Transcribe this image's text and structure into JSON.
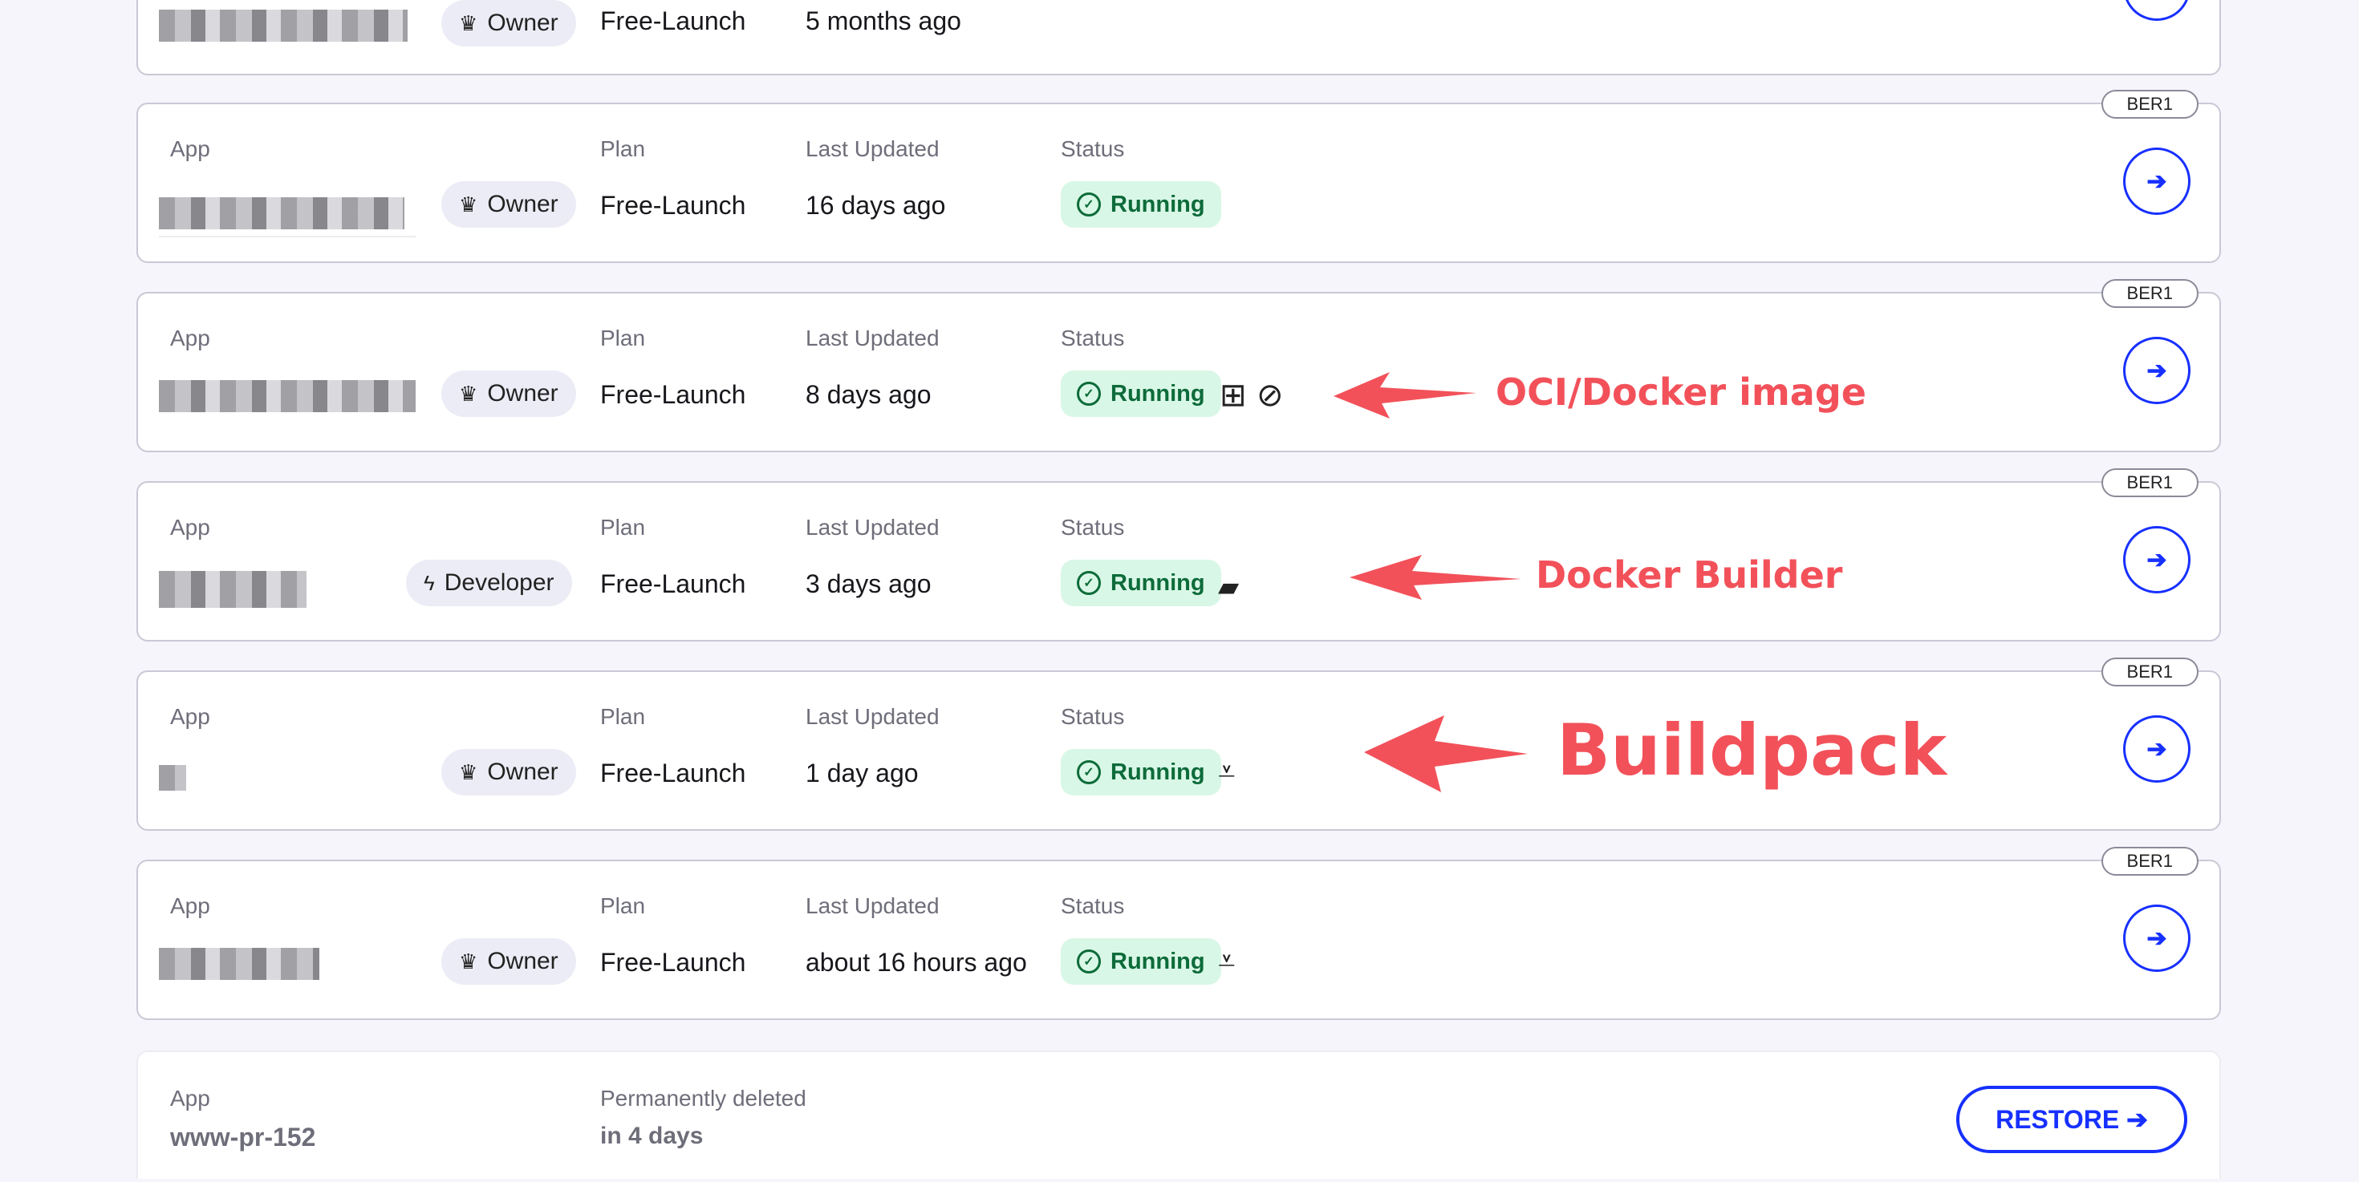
{
  "labels": {
    "app": "App",
    "plan": "Plan",
    "updated": "Last Updated",
    "status": "Status",
    "deleted": "Permanently deleted"
  },
  "top_row": {
    "role": "Owner",
    "plan": "Free-Launch",
    "updated": "5 months ago"
  },
  "rows": [
    {
      "region": "BER1",
      "role": "Owner",
      "role_icon": "crown-icon",
      "plan": "Free-Launch",
      "updated": "16 days ago",
      "status": "Running",
      "build_icon": "none"
    },
    {
      "region": "BER1",
      "role": "Owner",
      "role_icon": "crown-icon",
      "plan": "Free-Launch",
      "updated": "8 days ago",
      "status": "Running",
      "build_icon": "oci-image-icon"
    },
    {
      "region": "BER1",
      "role": "Developer",
      "role_icon": "bolt-icon",
      "plan": "Free-Launch",
      "updated": "3 days ago",
      "status": "Running",
      "build_icon": "docker-icon"
    },
    {
      "region": "BER1",
      "role": "Owner",
      "role_icon": "crown-icon",
      "plan": "Free-Launch",
      "updated": "1 day ago",
      "status": "Running",
      "build_icon": "buildpack-icon"
    },
    {
      "region": "BER1",
      "role": "Owner",
      "role_icon": "crown-icon",
      "plan": "Free-Launch",
      "updated": "about 16 hours ago",
      "status": "Running",
      "build_icon": "buildpack-icon"
    }
  ],
  "deleted_app": {
    "name": "www-pr-152",
    "when": "in 4 days",
    "restore": "RESTORE ➔"
  },
  "annotations": {
    "oci": "OCI/Docker image",
    "docker": "Docker Builder",
    "buildpack": "Buildpack"
  },
  "colors": {
    "accent": "#1730ff",
    "running_bg": "#d9f7e6",
    "running_text": "#0d6b3a",
    "annotation": "#f2515a"
  }
}
